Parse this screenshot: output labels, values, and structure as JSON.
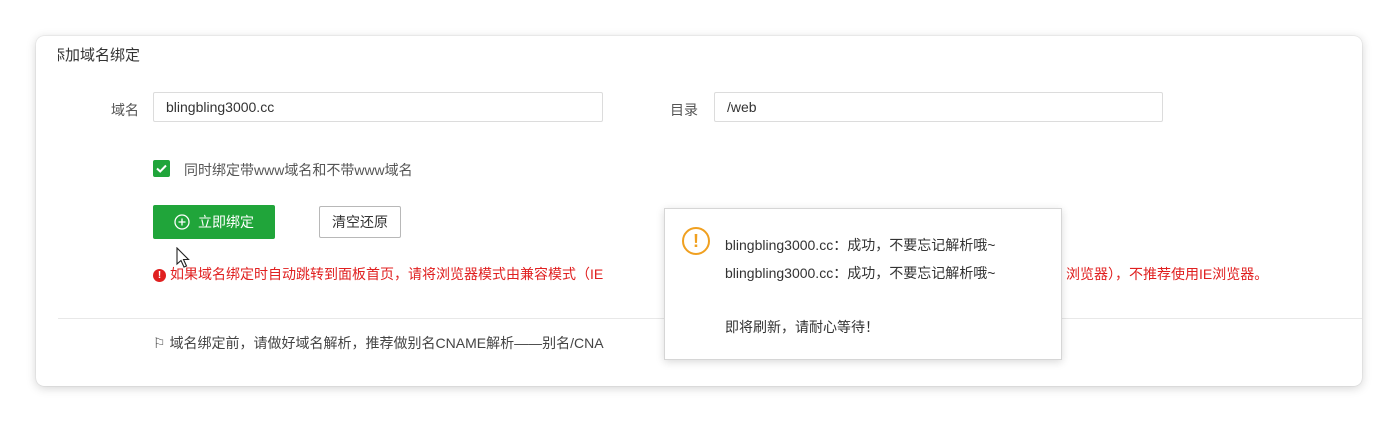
{
  "dialog": {
    "title": "添加域名绑定",
    "domain_label": "域名",
    "domain_value": "blingbling3000.cc",
    "dir_label": "目录",
    "dir_value": "/web",
    "checkbox_label": "同时绑定带www域名和不带www域名",
    "bind_button": "立即绑定",
    "reset_button": "清空还原",
    "warning_visible": "如果域名绑定时自动跳转到面板首页，请将浏览器模式由兼容模式（IE",
    "warning_tail": "浏览器），不推荐使用IE浏览器。",
    "tip_visible": "域名绑定前，请做好域名解析，推荐做别名CNAME解析——别名/CNA"
  },
  "toast": {
    "line1": "blingbling3000.cc：成功，不要忘记解析哦~",
    "line2": "blingbling3000.cc：成功，不要忘记解析哦~",
    "line3": "即将刷新，请耐心等待！",
    "icon": "exclamation-icon"
  },
  "colors": {
    "accent": "#20a53a",
    "warning_text": "#e02020",
    "toast_icon": "#f0a020"
  }
}
